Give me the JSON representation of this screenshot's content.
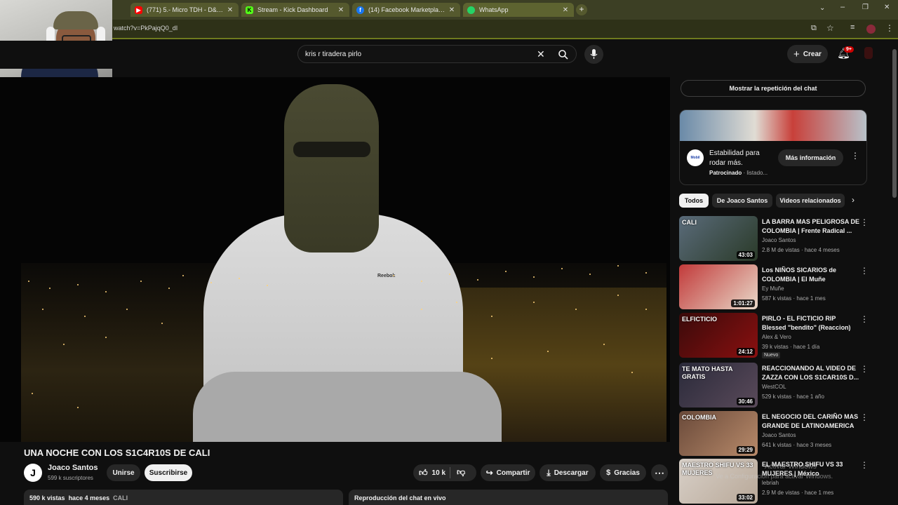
{
  "browser": {
    "tabs": [
      {
        "title": "(771) 5.- Micro TDH - D&D (Inedita)",
        "icon": "youtube-icon",
        "color": "#ff0000"
      },
      {
        "title": "Stream - Kick Dashboard",
        "icon": "kick-icon",
        "color": "#53fc18"
      },
      {
        "title": "(14) Facebook Marketplace | Fa",
        "icon": "facebook-icon",
        "color": "#1877f2"
      },
      {
        "title": "WhatsApp",
        "icon": "whatsapp-icon",
        "color": "#25d366"
      }
    ],
    "url": "watch?v=PkPajqQ0_dI"
  },
  "header": {
    "search_query": "kris r tiradera pirlo",
    "create_label": "Crear",
    "notif_badge": "9+"
  },
  "video": {
    "title": "UNA NOCHE CON LOS S1C4R10S DE CALI",
    "channel": "Joaco Santos",
    "channel_initial": "J",
    "subscribers": "599 k suscriptores",
    "join_label": "Unirse",
    "subscribe_label": "Suscribirse",
    "likes": "10 k",
    "share_label": "Compartir",
    "download_label": "Descargar",
    "thanks_label": "Gracias",
    "views": "590 k vistas",
    "age": "hace 4 meses",
    "location": "CALI",
    "chat_replay_label": "Reproducción del chat en vivo",
    "shirt_brand": "Reebok"
  },
  "sidebar": {
    "show_chat_label": "Mostrar la repetición del chat",
    "ad": {
      "title": "Estabilidad para rodar más.",
      "sponsored": "Patrocinado",
      "advertiser": "listado...",
      "cta": "Más información",
      "logo_text": "Mobil"
    },
    "chips": [
      "Todos",
      "De Joaco Santos",
      "Videos relacionados"
    ],
    "videos": [
      {
        "title": "LA BARRA MAS PELIGROSA DE COLOMBIA | Frente Radical ...",
        "channel": "Joaco Santos",
        "meta": "2.8 M de vistas · hace 4 meses",
        "duration": "43:03",
        "thumb_text": "CALI",
        "c1": "#5a6b7a",
        "c2": "#2a3a28"
      },
      {
        "title": "Los NIÑOS SICARIOS de COLOMBIA | El Muñe",
        "channel": "Ey Muñe",
        "meta": "587 k vistas · hace 1 mes",
        "duration": "1:01:27",
        "thumb_text": "",
        "c1": "#c23a3a",
        "c2": "#e8d8c8"
      },
      {
        "title": "PIRLO - EL FICTICIO RIP Blessed \"bendito\" (Reaccion)",
        "channel": "Alex & Vero",
        "meta": "39 k vistas · hace 1 día",
        "badge": "Nuevo",
        "duration": "24:12",
        "thumb_text": "ELFICTICIO",
        "c1": "#3a0a0a",
        "c2": "#8a1010"
      },
      {
        "title": "REACCIONANDO AL VIDEO DE ZAZZA CON LOS S1CAR10S D...",
        "channel": "WestCOL",
        "meta": "529 k vistas · hace 1 año",
        "duration": "30:46",
        "thumb_text": "TE MATO HASTA GRATIS",
        "c1": "#2a2a3a",
        "c2": "#5a4a5a"
      },
      {
        "title": "EL NEGOCIO DEL CARIÑO MAS GRANDE DE LATINOAMERICA ...",
        "channel": "Joaco Santos",
        "meta": "641 k vistas · hace 3 meses",
        "duration": "29:29",
        "thumb_text": "COLOMBIA",
        "c1": "#6a4a3a",
        "c2": "#b88a6a"
      },
      {
        "title": "EL MAESTRO SHIFU VS 33 MUJERES | México",
        "channel": "lebriah",
        "meta": "2.9 M de vistas · hace 1 mes",
        "duration": "33:02",
        "thumb_text": "MAESTRO SHIFU VS 33 MUJERES",
        "c1": "#d8d0c8",
        "c2": "#b8a898"
      }
    ]
  },
  "watermark": {
    "line1": "Activar Windows",
    "line2": "Ve a Configuración para activar Windows."
  }
}
